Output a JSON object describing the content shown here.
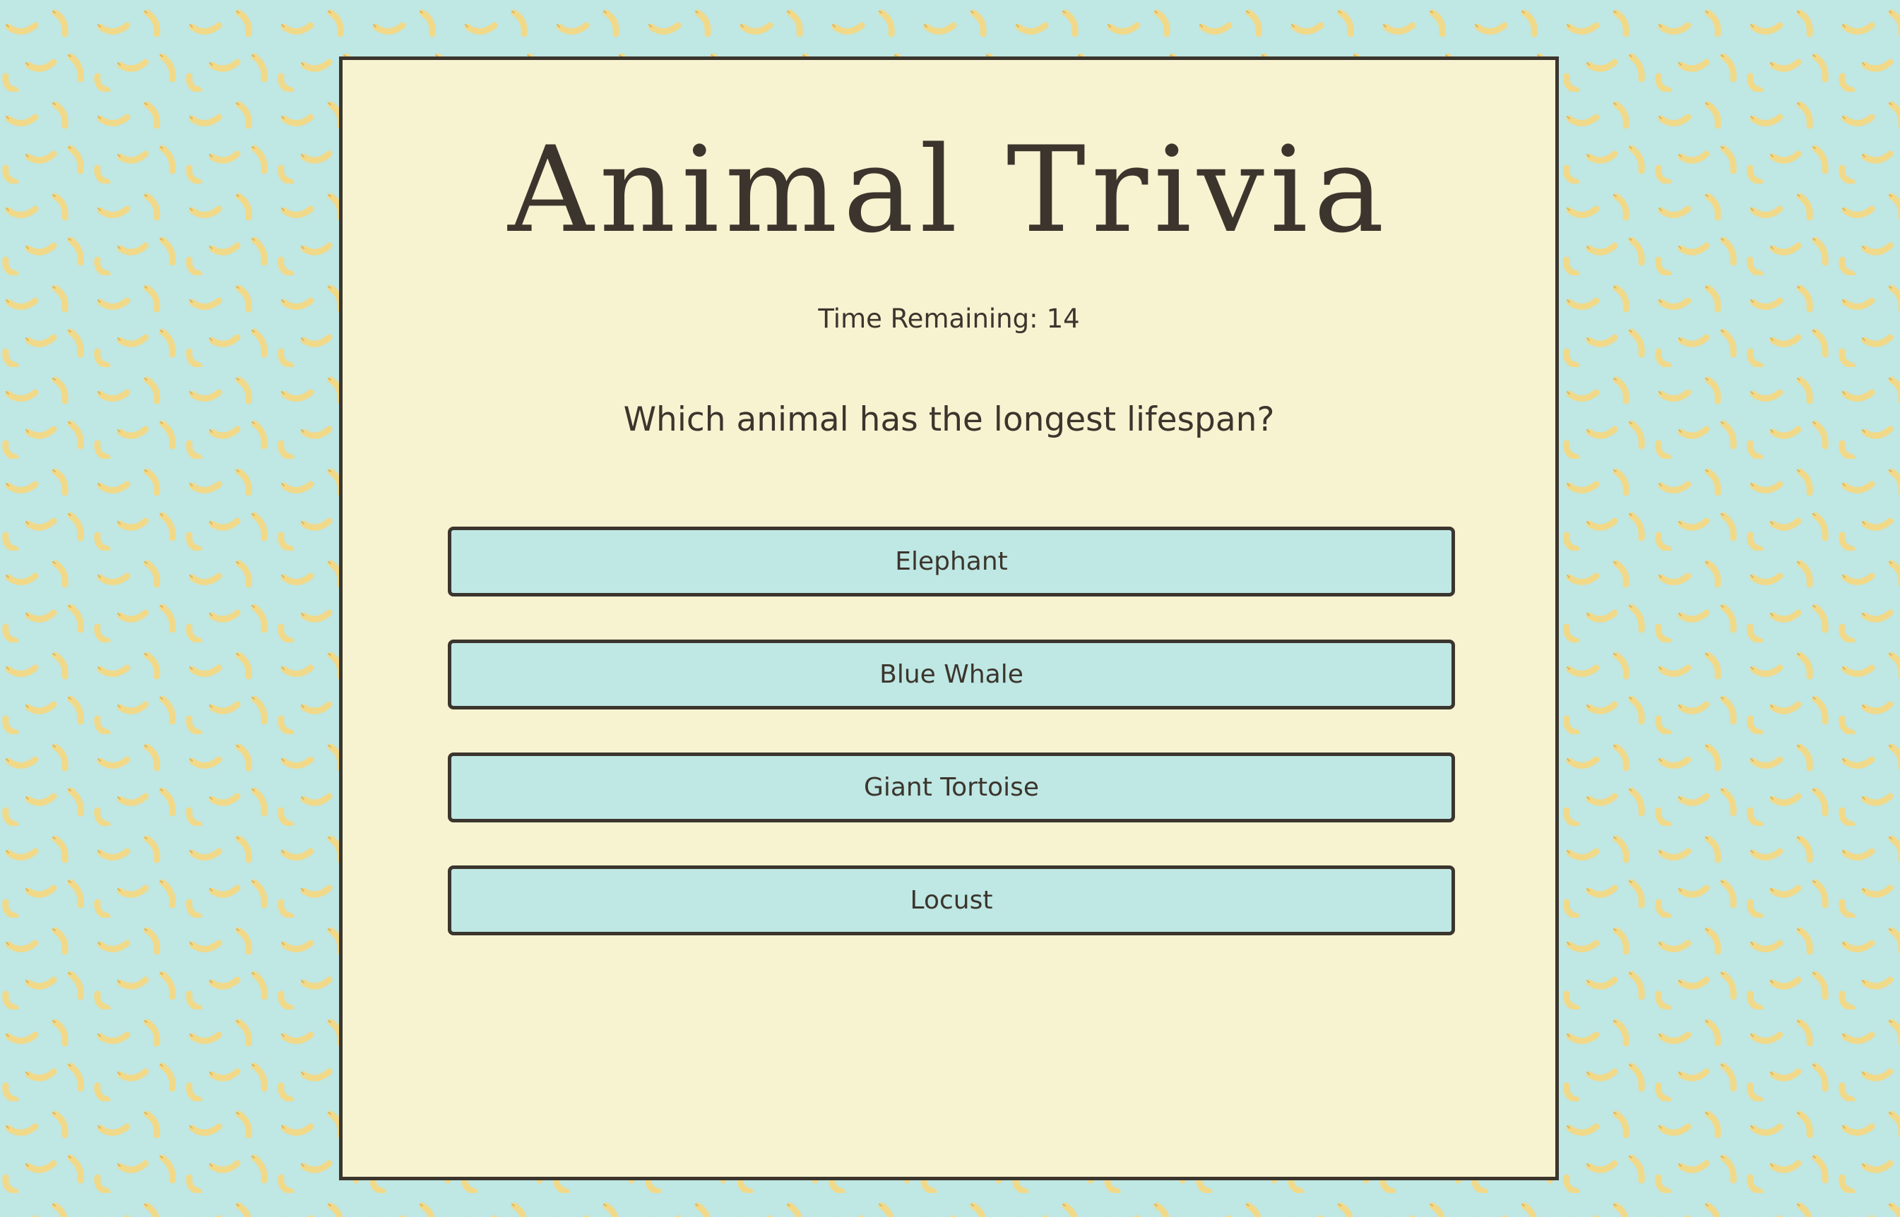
{
  "page": {
    "background_color": "#bfe7e3",
    "pattern_icon": "banana-icon",
    "pattern_color": "#f1d98a"
  },
  "quiz": {
    "title": "Animal Trivia",
    "timer_label": "Time Remaining:",
    "timer_value": "14",
    "question": "Which animal has the longest lifespan?",
    "answers": [
      {
        "label": "Elephant"
      },
      {
        "label": "Blue Whale"
      },
      {
        "label": "Giant Tortoise"
      },
      {
        "label": "Locust"
      }
    ]
  },
  "colors": {
    "card_bg": "#f7f2d0",
    "border": "#3b352d",
    "button_bg": "#bfe7e3",
    "text": "#3b352d"
  }
}
